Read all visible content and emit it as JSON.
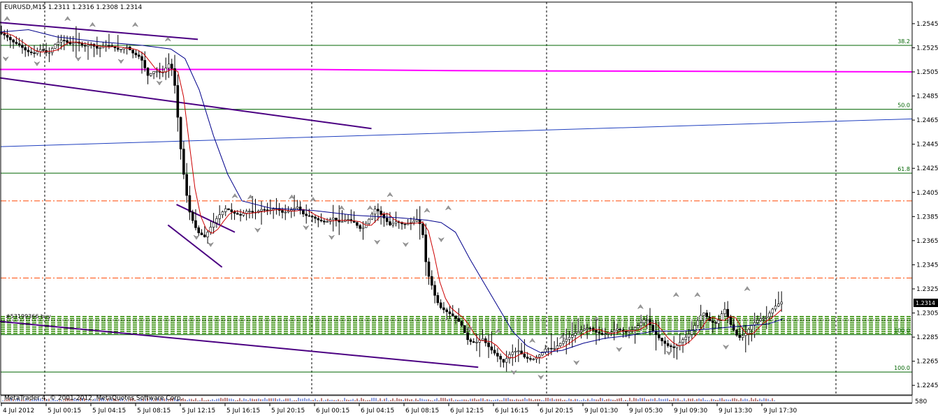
{
  "window": {
    "symbol_label": "EURUSD,M15  1.2311 1.2316 1.2308 1.2314",
    "order_label": "#53199366 buy",
    "footer_label": "MetaTrader 4, © 2001-2012, MetaQuotes Software Corp.",
    "bottom_right_label": "580"
  },
  "colors": {
    "background": "#ffffff",
    "candle": "#000000",
    "ma_fast": "#cc0000",
    "ma_slow": "#00008b",
    "trendline": "#4b0082",
    "magenta_line": "#ff00ff",
    "fib_line": "#006400",
    "dash_line": "#ff4500",
    "fractal": "#808080",
    "price_box_bg": "#000000",
    "price_box_fg": "#ffffff"
  },
  "chart_data": {
    "type": "candlestick",
    "symbol": "EURUSD",
    "timeframe": "M15",
    "current_price": "1.2314",
    "ohlc_header": {
      "open": 1.2311,
      "high": 1.2316,
      "low": 1.2308,
      "close": 1.2314
    },
    "ylim": [
      1.2237,
      1.256
    ],
    "y_ticks": [
      "1.2545",
      "1.2525",
      "1.2505",
      "1.2485",
      "1.2465",
      "1.2445",
      "1.2425",
      "1.2405",
      "1.2385",
      "1.2365",
      "1.2345",
      "1.2325",
      "1.2305",
      "1.2285",
      "1.2265",
      "1.2245"
    ],
    "x_ticks": [
      "4 Jul 2012",
      "5 Jul 00:15",
      "5 Jul 04:15",
      "5 Jul 08:15",
      "5 Jul 12:15",
      "5 Jul 16:15",
      "5 Jul 20:15",
      "6 Jul 00:15",
      "6 Jul 04:15",
      "6 Jul 08:15",
      "6 Jul 12:15",
      "6 Jul 16:15",
      "6 Jul 20:15",
      "9 Jul 01:30",
      "9 Jul 05:30",
      "9 Jul 09:30",
      "9 Jul 13:30",
      "9 Jul 17:30"
    ],
    "fib_levels": [
      {
        "label": "38.2",
        "price": 1.2527
      },
      {
        "label": "50.0",
        "price": 1.2474
      },
      {
        "label": "61.8",
        "price": 1.2421
      },
      {
        "label": "100.0",
        "price": 1.2287
      },
      {
        "label": "100.0",
        "price": 1.2256
      }
    ],
    "dashed_levels": [
      1.2398,
      1.2334
    ],
    "order_level": 1.2299,
    "buy_zone": [
      1.2288,
      1.2302
    ],
    "magenta_line": [
      [
        0,
        1.2507
      ],
      [
        1100,
        1.2505
      ]
    ],
    "trendlines": [
      {
        "from": [
          0,
          1.2546
        ],
        "to": [
          278,
          1.2532
        ]
      },
      {
        "from": [
          0,
          1.25
        ],
        "to": [
          522,
          1.2458
        ]
      },
      {
        "from": [
          0,
          1.2298
        ],
        "to": [
          672,
          1.226
        ]
      },
      {
        "from": [
          248,
          1.2395
        ],
        "to": [
          330,
          1.2372
        ]
      },
      {
        "from": [
          236,
          1.2378
        ],
        "to": [
          312,
          1.2343
        ]
      }
    ],
    "blue_line": {
      "from": [
        0,
        1.2443
      ],
      "to": [
        1100,
        1.2466
      ]
    },
    "price_path": [
      [
        0,
        1.2538
      ],
      [
        10,
        1.2535
      ],
      [
        20,
        1.253
      ],
      [
        30,
        1.2527
      ],
      [
        40,
        1.2522
      ],
      [
        50,
        1.252
      ],
      [
        60,
        1.2524
      ],
      [
        70,
        1.252
      ],
      [
        80,
        1.2528
      ],
      [
        90,
        1.2532
      ],
      [
        100,
        1.2528
      ],
      [
        110,
        1.253
      ],
      [
        120,
        1.2526
      ],
      [
        130,
        1.2528
      ],
      [
        140,
        1.2524
      ],
      [
        150,
        1.2527
      ],
      [
        160,
        1.2526
      ],
      [
        170,
        1.2523
      ],
      [
        180,
        1.2526
      ],
      [
        190,
        1.252
      ],
      [
        200,
        1.2517
      ],
      [
        210,
        1.2502
      ],
      [
        220,
        1.2506
      ],
      [
        230,
        1.2504
      ],
      [
        240,
        1.2512
      ],
      [
        246,
        1.2505
      ],
      [
        250,
        1.248
      ],
      [
        256,
        1.2442
      ],
      [
        262,
        1.2412
      ],
      [
        268,
        1.239
      ],
      [
        274,
        1.238
      ],
      [
        280,
        1.2372
      ],
      [
        290,
        1.2368
      ],
      [
        300,
        1.2378
      ],
      [
        310,
        1.2386
      ],
      [
        320,
        1.2392
      ],
      [
        330,
        1.2388
      ],
      [
        340,
        1.2386
      ],
      [
        350,
        1.239
      ],
      [
        360,
        1.2388
      ],
      [
        370,
        1.2391
      ],
      [
        380,
        1.239
      ],
      [
        390,
        1.2392
      ],
      [
        400,
        1.2388
      ],
      [
        410,
        1.239
      ],
      [
        420,
        1.2393
      ],
      [
        430,
        1.2386
      ],
      [
        440,
        1.2385
      ],
      [
        450,
        1.2382
      ],
      [
        460,
        1.238
      ],
      [
        470,
        1.2384
      ],
      [
        480,
        1.238
      ],
      [
        490,
        1.2383
      ],
      [
        500,
        1.238
      ],
      [
        510,
        1.2374
      ],
      [
        520,
        1.2382
      ],
      [
        530,
        1.2392
      ],
      [
        540,
        1.2385
      ],
      [
        550,
        1.2378
      ],
      [
        560,
        1.2381
      ],
      [
        570,
        1.2378
      ],
      [
        580,
        1.238
      ],
      [
        590,
        1.2383
      ],
      [
        596,
        1.2372
      ],
      [
        602,
        1.234
      ],
      [
        608,
        1.233
      ],
      [
        614,
        1.2318
      ],
      [
        620,
        1.231
      ],
      [
        630,
        1.2306
      ],
      [
        640,
        1.2302
      ],
      [
        650,
        1.2296
      ],
      [
        660,
        1.2282
      ],
      [
        670,
        1.228
      ],
      [
        680,
        1.2284
      ],
      [
        690,
        1.2276
      ],
      [
        700,
        1.227
      ],
      [
        710,
        1.2264
      ],
      [
        720,
        1.2272
      ],
      [
        730,
        1.2274
      ],
      [
        740,
        1.2268
      ],
      [
        750,
        1.2266
      ],
      [
        760,
        1.227
      ],
      [
        770,
        1.2276
      ],
      [
        780,
        1.2275
      ],
      [
        790,
        1.228
      ],
      [
        800,
        1.2284
      ],
      [
        810,
        1.2288
      ],
      [
        820,
        1.2291
      ],
      [
        830,
        1.2293
      ],
      [
        840,
        1.2289
      ],
      [
        850,
        1.2287
      ],
      [
        860,
        1.2289
      ],
      [
        870,
        1.2292
      ],
      [
        880,
        1.2289
      ],
      [
        890,
        1.2291
      ],
      [
        900,
        1.2295
      ],
      [
        910,
        1.2301
      ],
      [
        920,
        1.229
      ],
      [
        930,
        1.2283
      ],
      [
        940,
        1.2278
      ],
      [
        950,
        1.2276
      ],
      [
        960,
        1.2282
      ],
      [
        970,
        1.2287
      ],
      [
        980,
        1.2296
      ],
      [
        990,
        1.2306
      ],
      [
        1000,
        1.2298
      ],
      [
        1010,
        1.2296
      ],
      [
        1020,
        1.2309
      ],
      [
        1030,
        1.2294
      ],
      [
        1040,
        1.2284
      ],
      [
        1050,
        1.2288
      ],
      [
        1060,
        1.2296
      ],
      [
        1070,
        1.23
      ],
      [
        1080,
        1.2302
      ],
      [
        1090,
        1.231
      ],
      [
        1100,
        1.2314
      ]
    ],
    "ma_slow_path": [
      [
        0,
        1.2538
      ],
      [
        40,
        1.254
      ],
      [
        80,
        1.2534
      ],
      [
        140,
        1.253
      ],
      [
        200,
        1.2527
      ],
      [
        240,
        1.2524
      ],
      [
        260,
        1.2516
      ],
      [
        280,
        1.249
      ],
      [
        300,
        1.2452
      ],
      [
        320,
        1.242
      ],
      [
        340,
        1.2398
      ],
      [
        380,
        1.2392
      ],
      [
        440,
        1.239
      ],
      [
        500,
        1.2386
      ],
      [
        560,
        1.2384
      ],
      [
        600,
        1.2382
      ],
      [
        620,
        1.238
      ],
      [
        640,
        1.2372
      ],
      [
        660,
        1.235
      ],
      [
        680,
        1.233
      ],
      [
        700,
        1.231
      ],
      [
        720,
        1.229
      ],
      [
        740,
        1.2278
      ],
      [
        760,
        1.2272
      ],
      [
        790,
        1.2274
      ],
      [
        820,
        1.228
      ],
      [
        850,
        1.2284
      ],
      [
        880,
        1.2286
      ],
      [
        920,
        1.229
      ],
      [
        960,
        1.229
      ],
      [
        1000,
        1.2292
      ],
      [
        1040,
        1.2294
      ],
      [
        1080,
        1.2296
      ],
      [
        1100,
        1.23
      ]
    ],
    "fractals_up": [
      [
        10,
        1.2551
      ],
      [
        95,
        1.2551
      ],
      [
        130,
        1.2546
      ],
      [
        190,
        1.2546
      ],
      [
        236,
        1.2534
      ],
      [
        330,
        1.2404
      ],
      [
        352,
        1.2403
      ],
      [
        410,
        1.2403
      ],
      [
        440,
        1.2401
      ],
      [
        480,
        1.2394
      ],
      [
        520,
        1.2394
      ],
      [
        548,
        1.2405
      ],
      [
        600,
        1.2392
      ],
      [
        630,
        1.2394
      ],
      [
        700,
        1.2292
      ],
      [
        748,
        1.2284
      ],
      [
        790,
        1.2287
      ],
      [
        838,
        1.2302
      ],
      [
        900,
        1.2312
      ],
      [
        950,
        1.2322
      ],
      [
        980,
        1.2322
      ],
      [
        1050,
        1.2327
      ]
    ],
    "fractals_down": [
      [
        8,
        1.2514
      ],
      [
        52,
        1.251
      ],
      [
        110,
        1.2514
      ],
      [
        170,
        1.2512
      ],
      [
        224,
        1.2494
      ],
      [
        276,
        1.2366
      ],
      [
        296,
        1.236
      ],
      [
        362,
        1.2372
      ],
      [
        430,
        1.2374
      ],
      [
        466,
        1.2366
      ],
      [
        530,
        1.2362
      ],
      [
        570,
        1.236
      ],
      [
        620,
        1.2364
      ],
      [
        660,
        1.229
      ],
      [
        722,
        1.2254
      ],
      [
        760,
        1.225
      ],
      [
        810,
        1.2262
      ],
      [
        870,
        1.2273
      ],
      [
        940,
        1.227
      ],
      [
        1020,
        1.2275
      ]
    ],
    "volume_strip": true,
    "grid": "vertical dotted separators",
    "legend": "none"
  }
}
